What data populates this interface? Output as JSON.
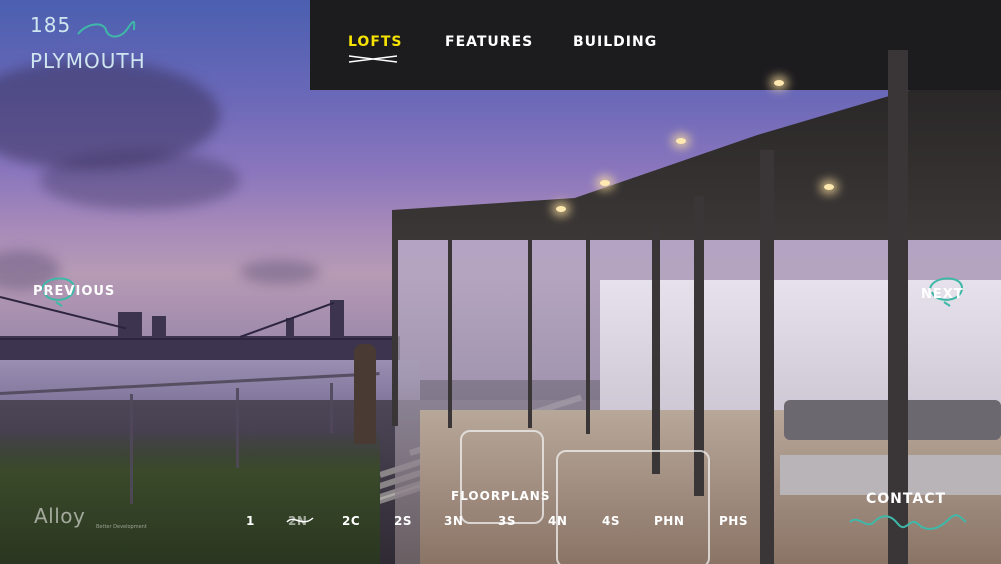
{
  "brand": {
    "logo_line1": "185",
    "logo_line2": "PLYMOUTH",
    "developer": "Alloy",
    "developer_sub": "Better Development"
  },
  "nav": {
    "items": [
      {
        "label": "LOFTS",
        "active": true
      },
      {
        "label": "FEATURES",
        "active": false
      },
      {
        "label": "BUILDING",
        "active": false
      }
    ]
  },
  "slider": {
    "previous_label": "PREVIOUS",
    "next_label": "NEXT"
  },
  "floorplans": {
    "title": "FLOORPLANS",
    "units": [
      {
        "label": "1",
        "sold": false
      },
      {
        "label": "2N",
        "sold": true
      },
      {
        "label": "2C",
        "sold": false
      },
      {
        "label": "2S",
        "sold": false
      },
      {
        "label": "3N",
        "sold": false
      },
      {
        "label": "3S",
        "sold": false
      },
      {
        "label": "4N",
        "sold": false
      },
      {
        "label": "4S",
        "sold": false
      },
      {
        "label": "PHN",
        "sold": false
      },
      {
        "label": "PHS",
        "sold": false
      }
    ]
  },
  "contact_label": "CONTACT",
  "colors": {
    "accent_yellow": "#f6e400",
    "accent_teal": "#3fb8a8",
    "text_white": "#ffffff"
  }
}
